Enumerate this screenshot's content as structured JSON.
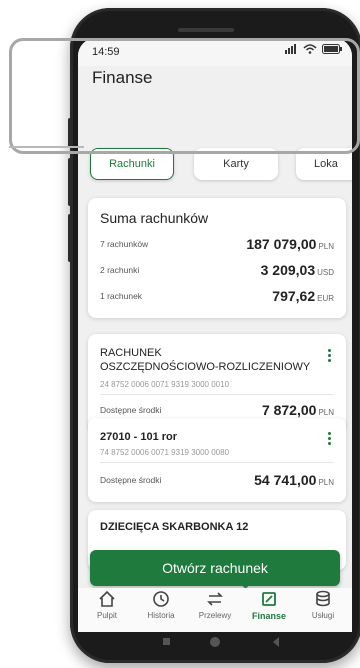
{
  "status": {
    "time": "14:59"
  },
  "header": {
    "title": "Finanse"
  },
  "tabs": [
    {
      "label": "Rachunki",
      "active": true
    },
    {
      "label": "Karty",
      "active": false
    },
    {
      "label": "Loka",
      "active": false
    }
  ],
  "summary": {
    "title": "Suma rachunków",
    "rows": [
      {
        "label": "7 rachunków",
        "amount": "187 079,00",
        "currency": "PLN"
      },
      {
        "label": "2 rachunki",
        "amount": "3 209,03",
        "currency": "USD"
      },
      {
        "label": "1 rachunek",
        "amount": "797,62",
        "currency": "EUR"
      }
    ]
  },
  "accounts": [
    {
      "name_line1": "RACHUNEK",
      "name_line2": "OSZCZĘDNOŚCIOWO-ROZLICZENIOWY",
      "number": "24 8752 0006 0071 9319 3000 0010",
      "avail_label": "Dostępne środki",
      "amount": "7 872,00",
      "currency": "PLN"
    },
    {
      "name_line1": "27010 - 101 ror",
      "number": "74 8752 0006 0071 9319 3000 0080",
      "avail_label": "Dostępne środki",
      "amount": "54 741,00",
      "currency": "PLN"
    },
    {
      "name_line1": "DZIECIĘCA SKARBONKA 12"
    }
  ],
  "cta": {
    "label": "Otwórz rachunek"
  },
  "nav": [
    {
      "label": "Pulpit",
      "icon": "home-icon"
    },
    {
      "label": "Historia",
      "icon": "history-icon"
    },
    {
      "label": "Przelewy",
      "icon": "transfer-icon"
    },
    {
      "label": "Finanse",
      "icon": "finance-icon",
      "active": true
    },
    {
      "label": "Usługi",
      "icon": "services-icon"
    }
  ],
  "colors": {
    "accent": "#1f7a3d",
    "highlight": "#a7a7a7"
  }
}
